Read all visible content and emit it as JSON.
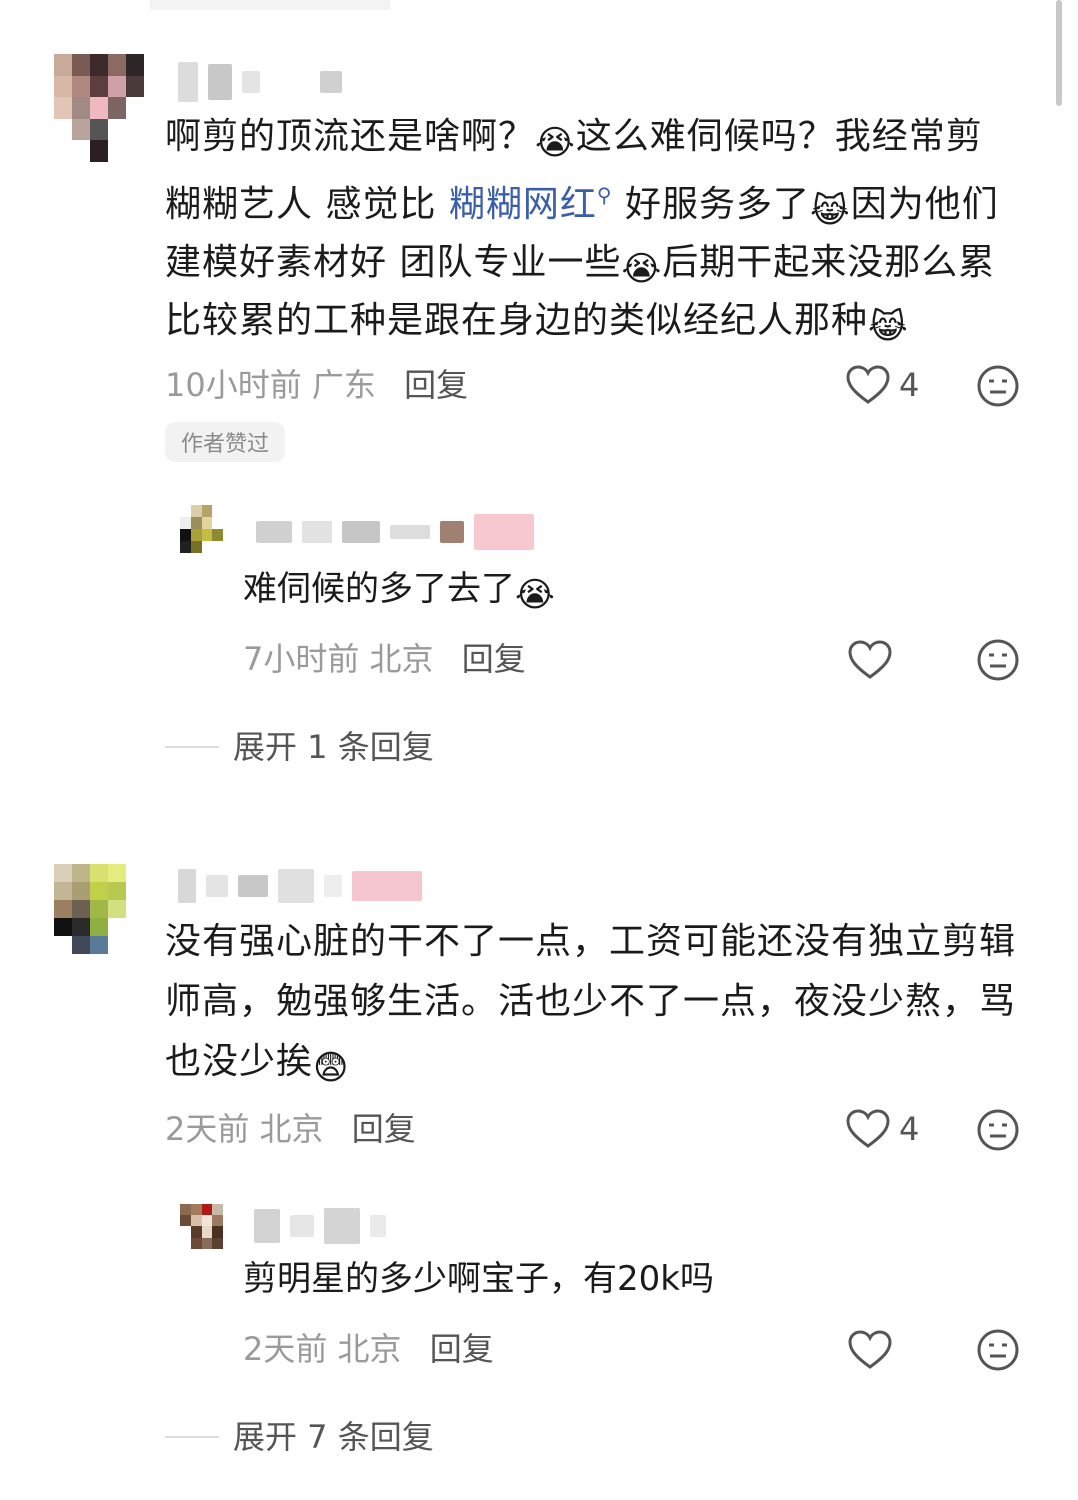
{
  "comments": [
    {
      "text_parts": [
        "啊剪的顶流还是啥啊？",
        "这么难伺候吗？我经常剪",
        "糊糊艺人 感觉比 ",
        "糊糊网红",
        " 好服务多了",
        "因为他们",
        "建模好素材好 团队专业一些",
        "后期干起来没那么累",
        "比较累的工种是跟在身边的类似经纪人那种"
      ],
      "time": "10小时前",
      "location": "广东",
      "reply_label": "回复",
      "likes": "4",
      "badge": "作者赞过",
      "replies": [
        {
          "text": "难伺候的多了去了",
          "time": "7小时前",
          "location": "北京",
          "reply_label": "回复"
        }
      ],
      "expand_label": "展开 1 条回复"
    },
    {
      "text_parts": [
        "没有强心脏的干不了一点，工资可能还没有独立剪辑",
        "师高，勉强够生活。活也少不了一点，夜没少熬，骂",
        "也没少挨"
      ],
      "time": "2天前",
      "location": "北京",
      "reply_label": "回复",
      "likes": "4",
      "replies": [
        {
          "text": "剪明星的多少啊宝子，有20k吗",
          "time": "2天前",
          "location": "北京",
          "reply_label": "回复"
        }
      ],
      "expand_label": "展开 7 条回复"
    }
  ],
  "icons": {
    "like": "heart-outline-icon",
    "more": "neutral-face-icon",
    "search_hint": "search-icon",
    "emoji_cry": "crying-face-emoji",
    "emoji_cat": "laughing-cat-emoji",
    "emoji_shock": "shocked-face-emoji"
  },
  "colors": {
    "keyword_link": "#3a5ea8",
    "meta_gray": "#9a9a9a"
  }
}
